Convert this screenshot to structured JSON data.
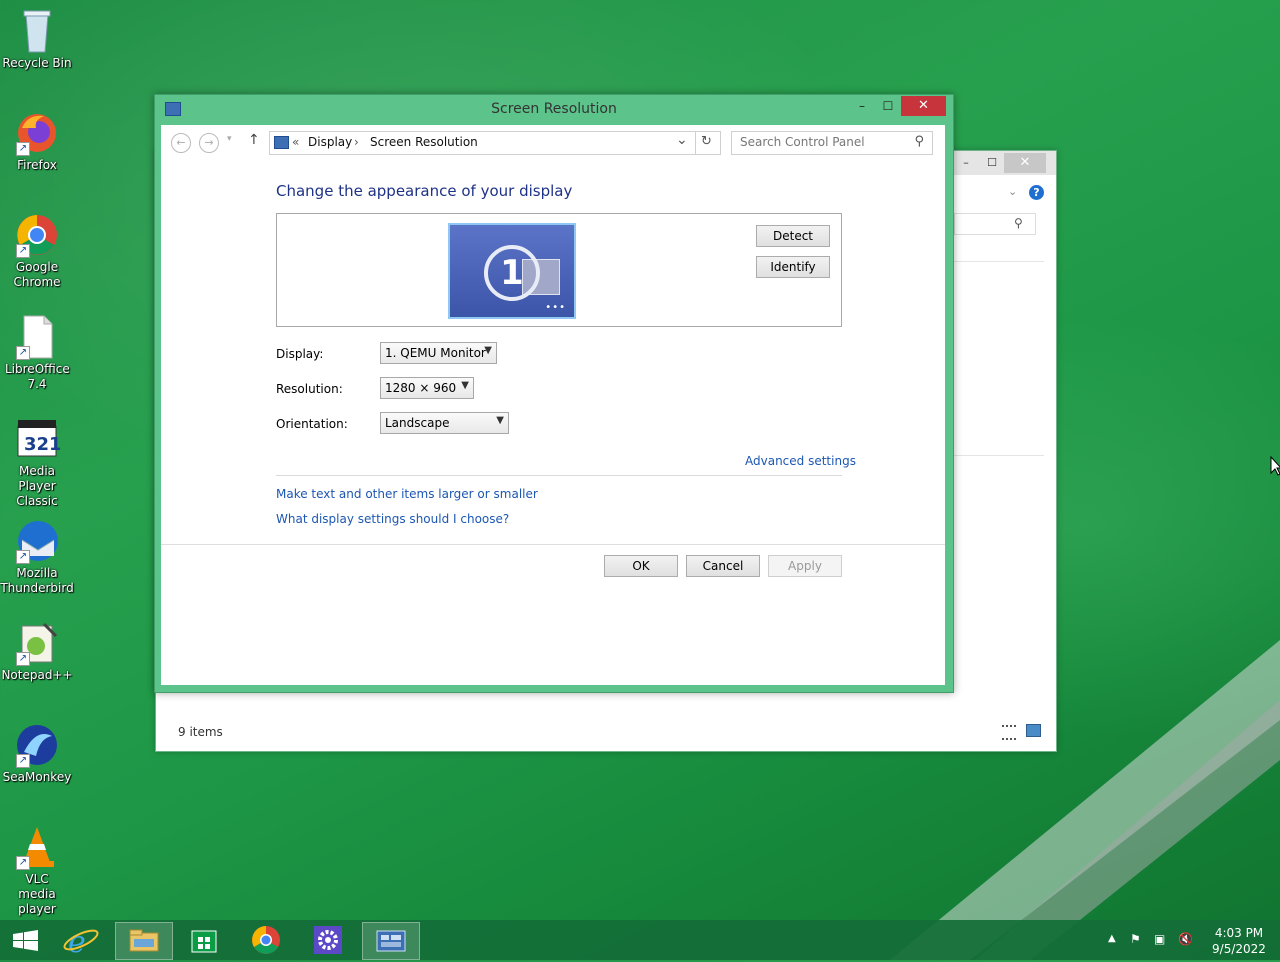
{
  "desktop": {
    "icons": [
      {
        "label": "Recycle Bin"
      },
      {
        "label": "Firefox"
      },
      {
        "label": "Google Chrome"
      },
      {
        "label": "LibreOffice 7.4"
      },
      {
        "label": "Media Player Classic"
      },
      {
        "label": "Mozilla Thunderbird"
      },
      {
        "label": "Notepad++"
      },
      {
        "label": "SeaMonkey"
      },
      {
        "label": "VLC media player"
      }
    ]
  },
  "back_window": {
    "minimize": "–",
    "maximize": "☐",
    "close": "✕",
    "status_text": "9 items"
  },
  "window": {
    "title": "Screen Resolution",
    "minimize": "–",
    "maximize": "☐",
    "close": "✕",
    "nav": {
      "back_icon": "←",
      "forward_icon": "→",
      "up_icon": "↑",
      "refresh_icon": "↻",
      "breadcrumb_sep": "«",
      "crumb_arrow": "›",
      "crumbs": [
        "Display",
        "Screen Resolution"
      ],
      "dropdown_icon": "⌄"
    },
    "search": {
      "placeholder": "Search Control Panel",
      "icon": "⚲"
    },
    "heading": "Change the appearance of your display",
    "monitor_number": "1",
    "detect_label": "Detect",
    "identify_label": "Identify",
    "fields": {
      "display_label": "Display:",
      "display_value": "1. QEMU Monitor",
      "resolution_label": "Resolution:",
      "resolution_value": "1280 × 960",
      "orientation_label": "Orientation:",
      "orientation_value": "Landscape"
    },
    "advanced_link": "Advanced settings",
    "links": [
      "Make text and other items larger or smaller",
      "What display settings should I choose?"
    ],
    "ok_label": "OK",
    "cancel_label": "Cancel",
    "apply_label": "Apply"
  },
  "taskbar": {
    "clock_time": "4:03 PM",
    "clock_date": "9/5/2022"
  }
}
